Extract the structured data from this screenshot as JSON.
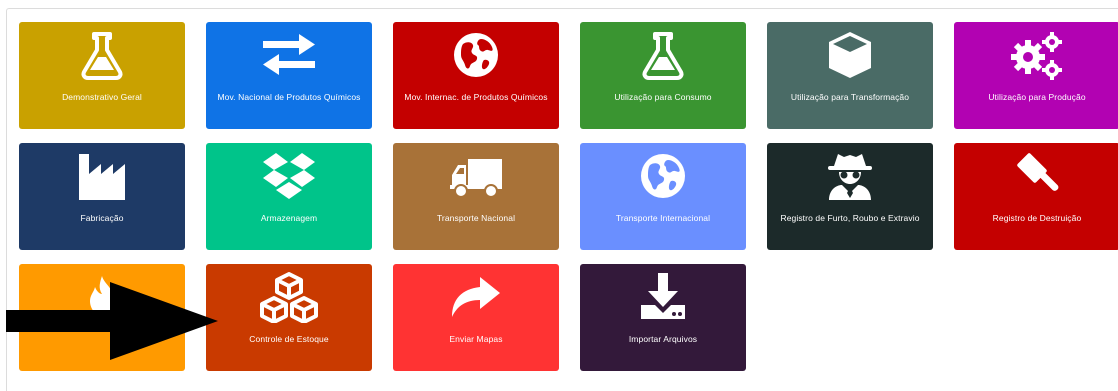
{
  "tiles": [
    {
      "label": "Demonstrativo Geral",
      "color": "#C9A100",
      "icon": "flask-icon"
    },
    {
      "label": "Mov. Nacional de Produtos Químicos",
      "color": "#0F73E6",
      "icon": "exchange-arrows-icon"
    },
    {
      "label": "Mov. Internac. de Produtos Químicos",
      "color": "#C40000",
      "icon": "globe-icon"
    },
    {
      "label": "Utilização para Consumo",
      "color": "#3A9531",
      "icon": "flask-icon"
    },
    {
      "label": "Utilização para Transformação",
      "color": "#4A6B66",
      "icon": "cube-icon"
    },
    {
      "label": "Utilização para Produção",
      "color": "#B202B2",
      "icon": "gears-icon"
    },
    {
      "label": "Fabricação",
      "color": "#1E3A66",
      "icon": "factory-icon"
    },
    {
      "label": "Armazenagem",
      "color": "#00C48A",
      "icon": "dropbox-icon"
    },
    {
      "label": "Transporte Nacional",
      "color": "#A87238",
      "icon": "truck-icon"
    },
    {
      "label": "Transporte Internacional",
      "color": "#6A8FFF",
      "icon": "globe-icon"
    },
    {
      "label": "Registro de Furto, Roubo e Extravio",
      "color": "#1C2A2A",
      "icon": "spy-icon"
    },
    {
      "label": "Registro de Destruição",
      "color": "#C40000",
      "icon": "gavel-icon"
    },
    {
      "label": "",
      "color": "#FF9A00",
      "icon": "fire-icon"
    },
    {
      "label": "Controle de Estoque",
      "color": "#C93A00",
      "icon": "cubes-icon"
    },
    {
      "label": "Enviar Mapas",
      "color": "#FF3333",
      "icon": "share-arrow-icon"
    },
    {
      "label": "Importar Arquivos",
      "color": "#33193A",
      "icon": "download-icon"
    }
  ]
}
